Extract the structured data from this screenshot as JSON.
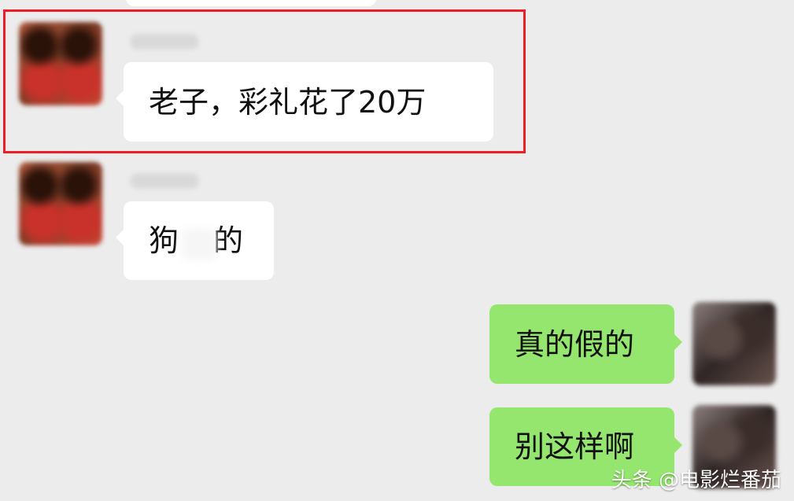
{
  "chat": {
    "messages": [
      {
        "side": "left",
        "text": "老子，彩礼花了20万"
      },
      {
        "side": "left",
        "text": "狗",
        "text_after_mask": "的"
      },
      {
        "side": "right",
        "text": "真的假的"
      },
      {
        "side": "right",
        "text": "别这样啊"
      }
    ]
  },
  "watermark": {
    "text": "头条 @电影烂番茄"
  },
  "colors": {
    "background": "#ececec",
    "incoming_bubble": "#ffffff",
    "outgoing_bubble": "#95e66e",
    "highlight_border": "#ee1c25",
    "watermark_text": "#ffffff"
  },
  "icons": {
    "incoming_avatar": "avatar-blurred-couple-red",
    "outgoing_avatar": "avatar-blurred-dark"
  }
}
